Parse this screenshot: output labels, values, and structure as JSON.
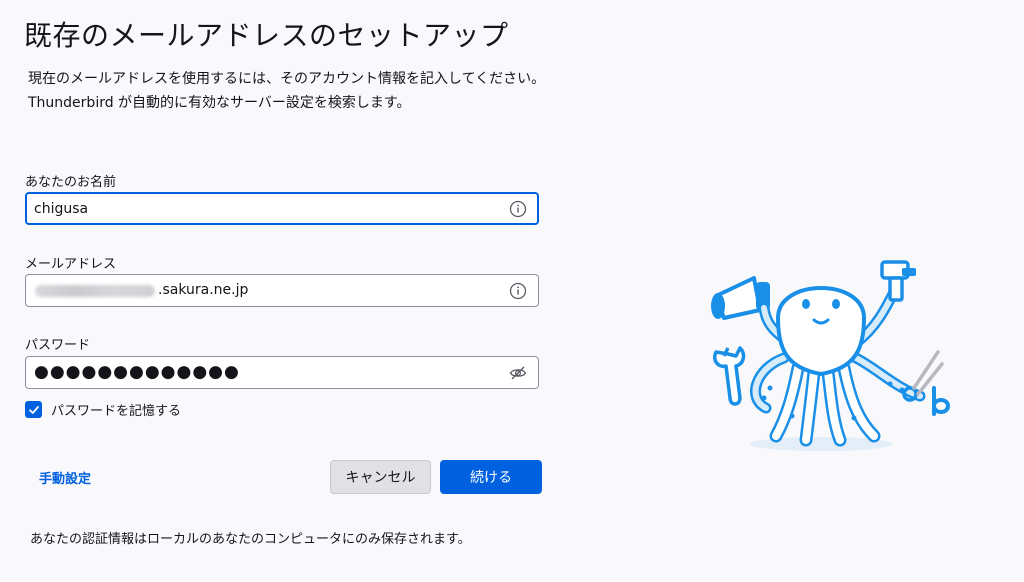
{
  "header": {
    "title": "既存のメールアドレスのセットアップ",
    "subtitle_line1": "現在のメールアドレスを使用するには、そのアカウント情報を記入してください。",
    "subtitle_line2": "Thunderbird が自動的に有効なサーバー設定を検索します。"
  },
  "form": {
    "name_label": "あなたのお名前",
    "name_value": "chigusa",
    "email_label": "メールアドレス",
    "email_domain_visible": ".sakura.ne.jp",
    "password_label": "パスワード",
    "password_dots": "●●●●●●●●●●●●●",
    "remember_label": "パスワードを記憶する",
    "remember_checked": true
  },
  "actions": {
    "manual_label": "手動設定",
    "cancel_label": "キャンセル",
    "continue_label": "続ける"
  },
  "footer": {
    "note": "あなたの認証情報はローカルのあなたのコンピュータにのみ保存されます。"
  },
  "icons": {
    "info": "info-icon",
    "password_visibility": "eye-hidden-icon",
    "checkmark": "checkmark-icon",
    "mascot": "octopus-mascot-illustration"
  },
  "colors": {
    "accent": "#0061e0",
    "background": "#f9f9fb",
    "cancel_button": "#e1e1e5",
    "mascot_blue": "#1a8fe8",
    "mascot_light": "#d6ecfb"
  }
}
